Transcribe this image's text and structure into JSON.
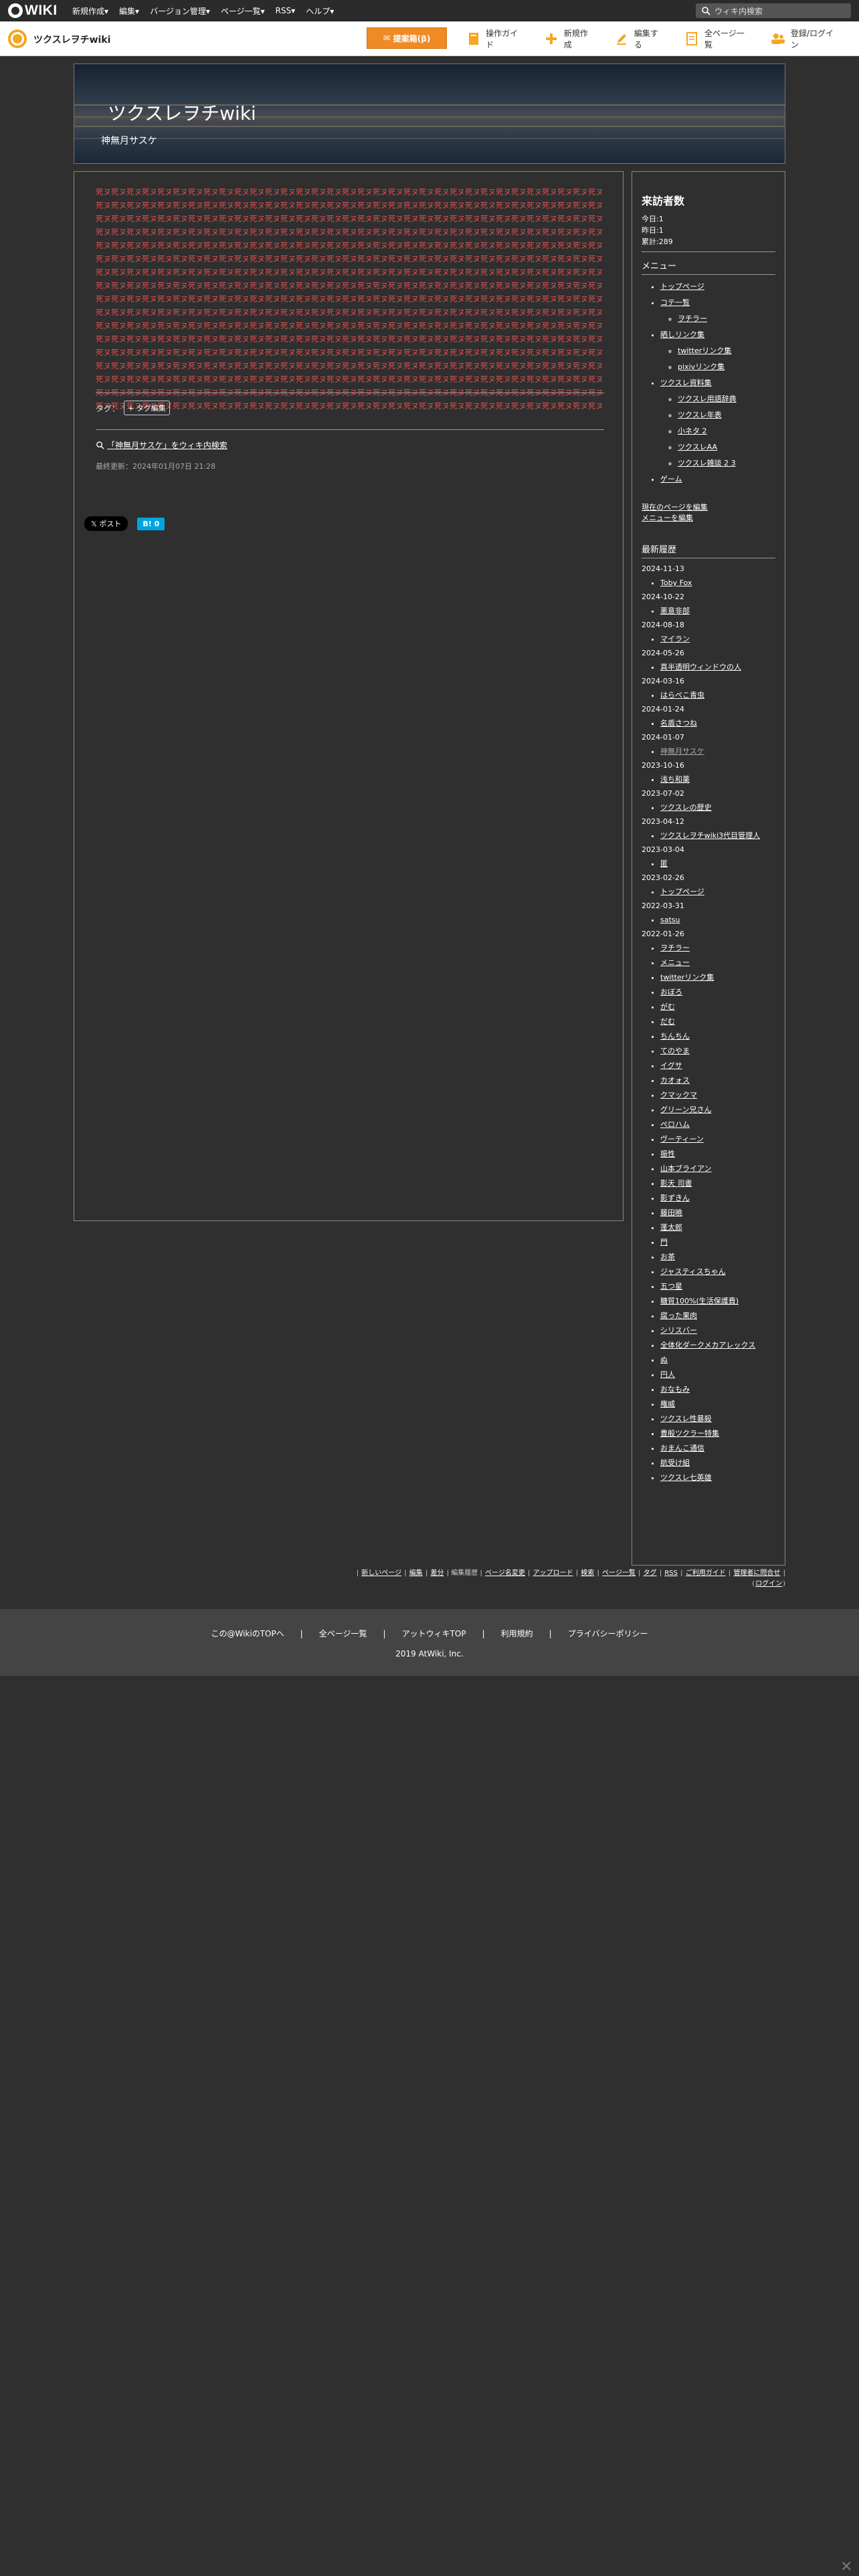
{
  "topbar": {
    "brand": "WIKI",
    "menu": [
      "新規作成▾",
      "編集▾",
      "バージョン管理▾",
      "ページ一覧▾",
      "RSS▾",
      "ヘルプ▾"
    ],
    "search_placeholder": "ウィキ内検索"
  },
  "sitebar": {
    "site_name": "ツクスレヲチwiki",
    "promo": "提案箱(β)",
    "tools": [
      "操作ガイド",
      "新規作成",
      "編集する",
      "全ページ一覧",
      "登録/ログイン"
    ]
  },
  "header": {
    "title": "ツクスレヲチwiki",
    "subtitle": "神無月サスケ"
  },
  "main": {
    "tiled_unit": "死ヌ死ヌ",
    "tag_label": "タグ：",
    "tag_button": "+ タグ編集",
    "search_link": "「神無月サスケ」をウィキ内検索",
    "updated": "最終更新：2024年01月07日 21:28",
    "post_button": "𝕏 ポスト",
    "hatena_button": "B! 0"
  },
  "side": {
    "visitors_title": "来訪者数",
    "today": "今日:1",
    "yesterday": "昨日:1",
    "total": "累計:289",
    "menu_title": "メニュー",
    "menu": [
      {
        "label": "トップページ",
        "children": []
      },
      {
        "label": "コテ一覧",
        "children": [
          "ヲチラー"
        ]
      },
      {
        "label": "晒しリンク集",
        "children": [
          "twitterリンク集",
          "pixivリンク集"
        ]
      },
      {
        "label": "ツクスレ資料集",
        "children": [
          "ツクスレ用語辞典",
          "ツクスレ年表",
          "小ネタ 2",
          "ツクスレAA",
          "ツクスレ雑談 2 3"
        ]
      },
      {
        "label": "ゲーム",
        "children": []
      }
    ],
    "edit_links": [
      "現在のページを編集",
      "メニューを編集"
    ],
    "history_title": "最新履歴",
    "history": [
      {
        "date": "2024-11-13",
        "items": [
          "Toby Fox"
        ]
      },
      {
        "date": "2024-10-22",
        "items": [
          "悪意非部"
        ]
      },
      {
        "date": "2024-08-18",
        "items": [
          "マイラン"
        ]
      },
      {
        "date": "2024-05-26",
        "items": [
          "真半透明ウィンドウの人"
        ]
      },
      {
        "date": "2024-03-16",
        "items": [
          "はらぺこ青虫"
        ]
      },
      {
        "date": "2024-01-24",
        "items": [
          "名盾さつね"
        ]
      },
      {
        "date": "2024-01-07",
        "items": [
          "神無月サスケ"
        ]
      },
      {
        "date": "2023-10-16",
        "items": [
          "浅ち和薬"
        ]
      },
      {
        "date": "2023-07-02",
        "items": [
          "ツクスレの歴史"
        ]
      },
      {
        "date": "2023-04-12",
        "items": [
          "ツクスレヲチwiki3代目管理人"
        ]
      },
      {
        "date": "2023-03-04",
        "items": [
          "匿"
        ]
      },
      {
        "date": "2023-02-26",
        "items": [
          "トップページ"
        ]
      },
      {
        "date": "2022-03-31",
        "items": [
          "satsu"
        ]
      },
      {
        "date": "2022-01-26",
        "items": [
          "ヲチラー",
          "メニュー",
          "twitterリンク集",
          "おぼろ",
          "がむ",
          "だむ",
          "ちんちん",
          "てのやま",
          "イグサ",
          "カオォス",
          "クマックマ",
          "グリーン兄さん",
          "ペロハム",
          "ヴーティーン",
          "振性",
          "山本ブライアン",
          "影天 司書",
          "影ずきん",
          "藤田暁",
          "蓬太郎",
          "門",
          "お茶",
          "ジャスティスちゃん",
          "五つ星",
          "糖質100%(生活保護費)",
          "腐った果肉",
          "シリスバー",
          "全体化ダークメカアレックス",
          "ぬ",
          "円人",
          "おなもみ",
          "権威",
          "ツクスレ性暴殺",
          "豊般ツクラー特集",
          "おまんこ通信",
          "航受け組",
          "ツクスレ七英雄"
        ]
      }
    ]
  },
  "footlinks": [
    "新しいページ",
    "編集",
    "差分",
    "編集履歴",
    "ページ名変更",
    "アップロード",
    "検索",
    "ページ一覧",
    "タグ",
    "RSS",
    "ご利用ガイド",
    "管理者に問合せ",
    "ログイン"
  ],
  "footer": {
    "links": [
      "この@WikiのTOPへ",
      "全ページ一覧",
      "アットウィキTOP",
      "利用規約",
      "プライバシーポリシー"
    ],
    "copyright": "2019 AtWiki, Inc."
  },
  "colors": {
    "accent": "#f08a24",
    "tiled_text": "#e05050",
    "background": "#2f2f2f"
  }
}
